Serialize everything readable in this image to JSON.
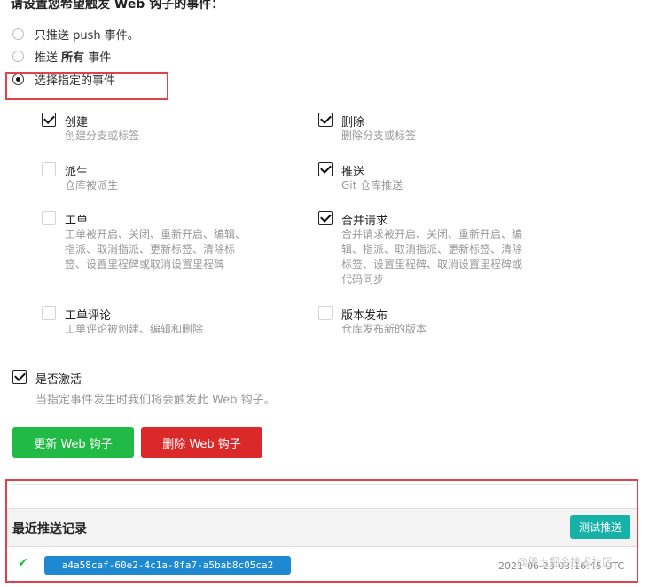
{
  "heading": "请设置您希望触发 Web 钩子的事件：",
  "trigger_options": [
    {
      "label": "只推送 push 事件。",
      "checked": false
    },
    {
      "label_pre": "推送 ",
      "label_bold": "所有",
      "label_post": " 事件",
      "checked": false
    },
    {
      "label": "选择指定的事件",
      "checked": true
    }
  ],
  "events": [
    {
      "title": "创建",
      "desc": "创建分支或标签",
      "checked": true
    },
    {
      "title": "删除",
      "desc": "删除分支或标签",
      "checked": true
    },
    {
      "title": "派生",
      "desc": "仓库被派生",
      "checked": false
    },
    {
      "title": "推送",
      "desc": "Git 仓库推送",
      "checked": true
    },
    {
      "title": "工单",
      "desc_lines": [
        "工单被开启、关闭、重新开启、编辑、",
        "指派、取消指派、更新标签、清除标",
        "签、设置里程碑或取消设置里程碑"
      ],
      "checked": false
    },
    {
      "title": "合并请求",
      "desc_lines": [
        "合并请求被开启、关闭、重新开启、编",
        "辑、指派、取消指派、更新标签、清除",
        "标签、设置里程碑、取消设置里程碑或",
        "代码同步"
      ],
      "checked": true
    },
    {
      "title": "工单评论",
      "desc": "工单评论被创建、编辑和删除",
      "checked": false
    },
    {
      "title": "版本发布",
      "desc": "仓库发布新的版本",
      "checked": false
    }
  ],
  "active": {
    "label": "是否激活",
    "desc": "当指定事件发生时我们将会触发此 Web 钩子。",
    "checked": true
  },
  "buttons": {
    "update": "更新 Web 钩子",
    "delete": "删除 Web 钩子"
  },
  "recent": {
    "title": "最近推送记录",
    "test_button": "测试推送",
    "deliveries": [
      {
        "status": "success",
        "sha": "a4a58caf-60e2-4c1a-8fa7-a5bab8c05ca2",
        "time": "2021-06-23 03:16:45 UTC"
      }
    ]
  },
  "watermark": "@稀土掘金技术社区",
  "colors": {
    "highlight_box": "#e0424a",
    "green": "#21ba45",
    "red": "#db2828",
    "teal": "#16b1a7",
    "blue": "#1e88d0"
  }
}
